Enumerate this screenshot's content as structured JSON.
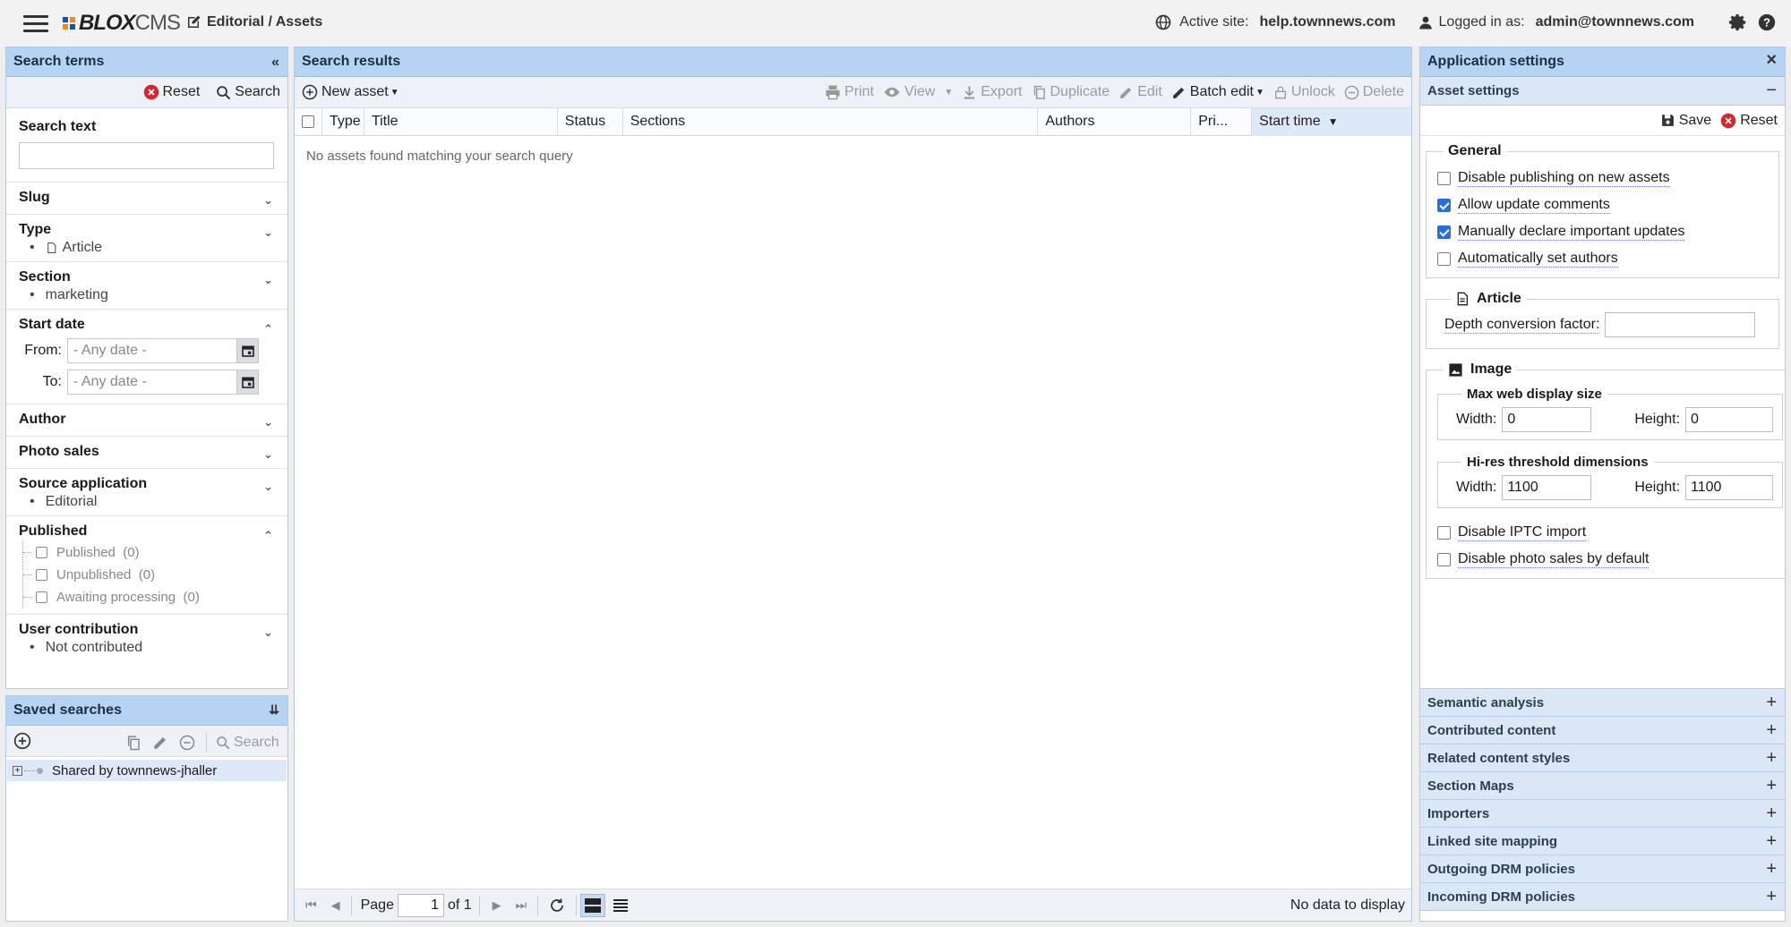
{
  "header": {
    "logo_blox": "BLOX",
    "logo_cms": "CMS",
    "breadcrumb": "Editorial / Assets",
    "active_site_label": "Active site:",
    "active_site_value": "help.townnews.com",
    "logged_in_label": "Logged in as:",
    "logged_in_value": "admin@townnews.com"
  },
  "search_terms": {
    "title": "Search terms",
    "reset_label": "Reset",
    "search_label": "Search",
    "search_text_label": "Search text",
    "search_text_value": "",
    "slug_label": "Slug",
    "type_label": "Type",
    "type_items": [
      "Article"
    ],
    "section_label": "Section",
    "section_items": [
      "marketing"
    ],
    "start_date_label": "Start date",
    "from_label": "From:",
    "to_label": "To:",
    "date_placeholder": "- Any date -",
    "author_label": "Author",
    "photo_sales_label": "Photo sales",
    "source_app_label": "Source application",
    "source_app_items": [
      "Editorial"
    ],
    "published_label": "Published",
    "published_items": [
      {
        "label": "Published",
        "count": "(0)"
      },
      {
        "label": "Unpublished",
        "count": "(0)"
      },
      {
        "label": "Awaiting processing",
        "count": "(0)"
      }
    ],
    "user_contrib_label": "User contribution",
    "user_contrib_items": [
      "Not contributed"
    ]
  },
  "saved_searches": {
    "title": "Saved searches",
    "search_label": "Search",
    "tree_item": "Shared by townnews-jhaller"
  },
  "results": {
    "title": "Search results",
    "new_asset_label": "New asset",
    "print_label": "Print",
    "view_label": "View",
    "export_label": "Export",
    "duplicate_label": "Duplicate",
    "edit_label": "Edit",
    "batch_edit_label": "Batch edit",
    "unlock_label": "Unlock",
    "delete_label": "Delete",
    "columns": [
      "Type",
      "Title",
      "Status",
      "Sections",
      "Authors",
      "Pri...",
      "Start time"
    ],
    "empty_text": "No assets found matching your search query",
    "page_label": "Page",
    "page_value": "1",
    "of_label": "of 1",
    "no_data_label": "No data to display"
  },
  "settings": {
    "title": "Application settings",
    "asset_settings_label": "Asset settings",
    "save_label": "Save",
    "reset_label": "Reset",
    "general_legend": "General",
    "general_options": [
      {
        "label": "Disable publishing on new assets",
        "checked": false
      },
      {
        "label": "Allow update comments",
        "checked": true
      },
      {
        "label": "Manually declare important updates",
        "checked": true
      },
      {
        "label": "Automatically set authors",
        "checked": false
      }
    ],
    "article_legend": "Article",
    "depth_label": "Depth conversion factor:",
    "depth_value": "",
    "image_legend": "Image",
    "max_web_legend": "Max web display size",
    "width_label": "Width:",
    "height_label": "Height:",
    "max_web_width": "0",
    "max_web_height": "0",
    "hires_legend": "Hi-res threshold dimensions",
    "hires_width": "1100",
    "hires_height": "1100",
    "disable_iptc": "Disable IPTC import",
    "disable_photo_sales": "Disable photo sales by default",
    "collapsed_sections": [
      "Semantic analysis",
      "Contributed content",
      "Related content styles",
      "Section Maps",
      "Importers",
      "Linked site mapping",
      "Outgoing DRM policies",
      "Incoming DRM policies"
    ]
  },
  "colors": {
    "panel_header": "#b7d3f3",
    "accent_blue": "#2a6cd9",
    "reset_red": "#d6262d"
  }
}
